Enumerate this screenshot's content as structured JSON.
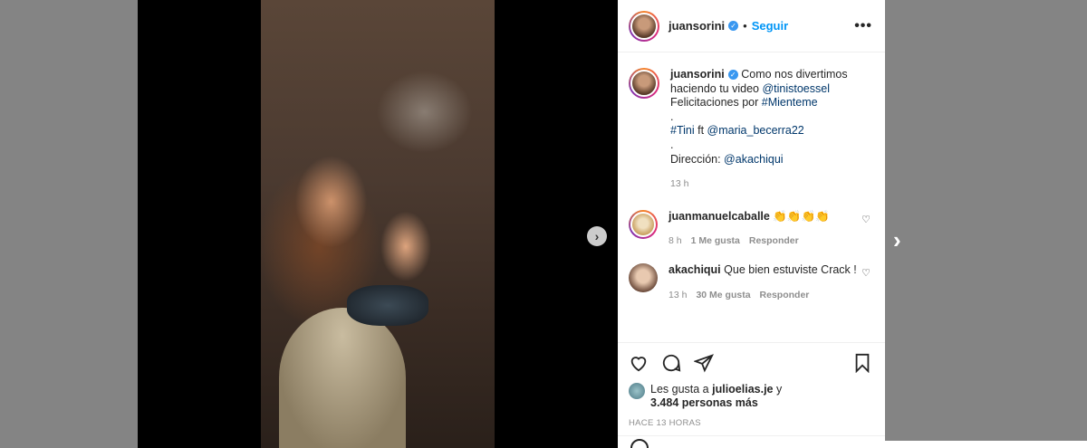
{
  "post": {
    "username": "juansorini",
    "follow_label": "Seguir",
    "more_label": "•••"
  },
  "caption": {
    "username": "juansorini",
    "text1": "Como nos divertimos haciendo tu video ",
    "mention1": "@tinistoessel",
    "text2": "Felicitaciones por ",
    "hashtag1": "#Mienteme",
    "dot1": ".",
    "hashtag2": "#Tini",
    "text3": " ft ",
    "mention2": "@maria_becerra22",
    "dot2": ".",
    "text4": "Dirección: ",
    "mention3": "@akachiqui",
    "time": "13 h"
  },
  "comments": [
    {
      "username": "juanmanuelcaballe",
      "text": "👏👏👏👏",
      "time": "8 h",
      "likes": "1 Me gusta",
      "reply": "Responder"
    },
    {
      "username": "akachiqui",
      "text": "Que bien estuviste Crack !",
      "time": "13 h",
      "likes": "30 Me gusta",
      "reply": "Responder"
    }
  ],
  "likes": {
    "prefix": "Les gusta a ",
    "user": "julioelias.je",
    "suffix": " y",
    "count": "3.484 personas más"
  },
  "timestamp": "HACE 13 HORAS",
  "icons": [
    "heart-icon",
    "comment-icon",
    "share-icon",
    "bookmark-icon",
    "chevron-right-icon",
    "verified-icon",
    "more-icon"
  ]
}
